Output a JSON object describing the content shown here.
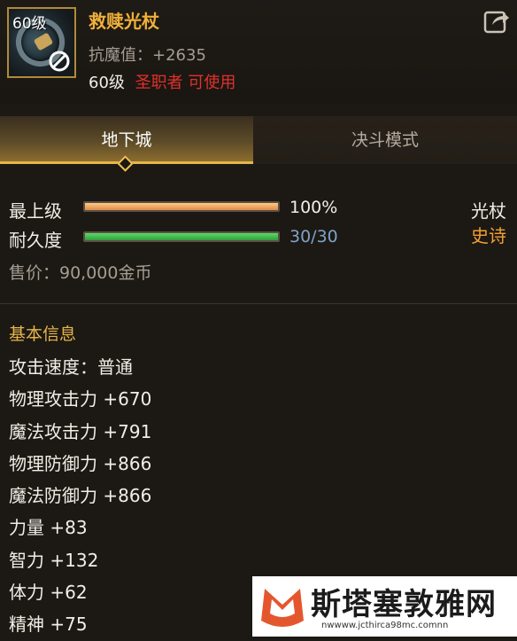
{
  "item": {
    "level_badge": "60级",
    "name": "救赎光杖",
    "magic_resist": "抗魔值：+2635",
    "required_level": "60级",
    "class_usable": "圣职者 可使用"
  },
  "tabs": [
    {
      "label": "地下城",
      "active": true
    },
    {
      "label": "决斗模式",
      "active": false
    }
  ],
  "stats": {
    "grade_label": "最上级",
    "grade_value": "100%",
    "grade_fraction": 1.0,
    "durability_label": "耐久度",
    "durability_value": "30/30",
    "durability_fraction": 1.0,
    "weapon_type": "光杖",
    "rarity": "史诗",
    "sell_price": "售价：90,000金币"
  },
  "basic_info": {
    "title": "基本信息",
    "attributes": [
      "攻击速度：普通",
      "物理攻击力 +670",
      "魔法攻击力 +791",
      "物理防御力 +866",
      "魔法防御力 +866",
      "力量 +83",
      "智力 +132",
      "体力 +62",
      "精神 +75"
    ]
  },
  "watermark": {
    "text": "斯塔塞敦雅网",
    "url": "nwwww.jcthirca98mc.comnn"
  },
  "colors": {
    "item_name": "#f0b03a",
    "class_req": "#e0312c",
    "rarity": "#f0a030",
    "tab_accent": "#e6b54a",
    "durability_value": "#7fa2c8"
  },
  "icons": [
    "no-use-icon",
    "share-icon",
    "tab-diamond-icon",
    "watermark-logo-icon"
  ]
}
